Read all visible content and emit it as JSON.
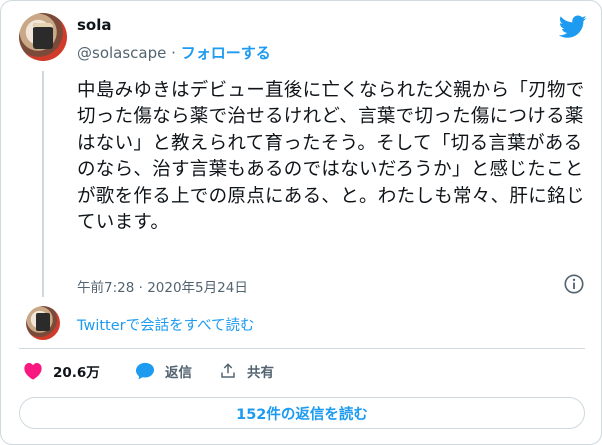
{
  "author": {
    "display_name": "sola",
    "handle": "@solascape",
    "separator": "·",
    "follow_label": "フォローする"
  },
  "tweet": {
    "text": "中島みゆきはデビュー直後に亡くなられた父親から「刃物で切った傷なら薬で治せるけれど、言葉で切った傷につける薬はない」と教えられて育ったそう。そして「切る言葉があるのなら、治す言葉もあるのではないだろうか」と感じたことが歌を作る上での原点にある、と。わたしも常々、肝に銘じています。",
    "timestamp": "午前7:28 · 2020年5月24日"
  },
  "conversation": {
    "read_label": "Twitterで会話をすべて読む"
  },
  "actions": {
    "likes": "20.6万",
    "reply_label": "返信",
    "share_label": "共有"
  },
  "replies_button_label": "152件の返信を読む",
  "colors": {
    "accent": "#1d9bf0",
    "like": "#f91880",
    "muted": "#536471",
    "border": "#cfd9de"
  },
  "icons": {
    "brand": "twitter-bird-icon",
    "info": "info-icon",
    "like": "heart-icon",
    "reply": "reply-bubble-icon",
    "share": "share-upload-icon"
  }
}
